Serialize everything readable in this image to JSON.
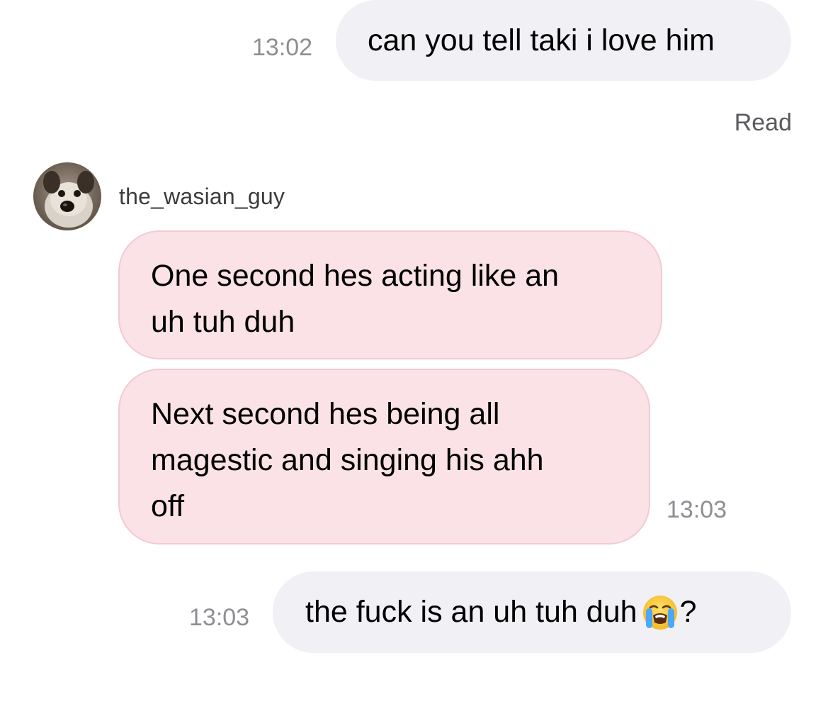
{
  "conversation": {
    "messages": [
      {
        "direction": "outgoing",
        "text": "can you tell taki i love him",
        "time": "13:02"
      },
      {
        "direction": "incoming",
        "sender": "the_wasian_guy",
        "text_lines": [
          "One second hes acting like an",
          "uh tuh duh"
        ]
      },
      {
        "direction": "incoming",
        "sender": "the_wasian_guy",
        "text_lines": [
          "Next second hes being all",
          "magestic and singing his ahh",
          "off"
        ],
        "time": "13:03"
      },
      {
        "direction": "outgoing",
        "text": "the fuck is an uh tuh duh",
        "emoji": "loudly-crying-face-emoji",
        "suffix": "?",
        "time": "13:03"
      }
    ],
    "read_receipt": "Read",
    "contact": {
      "username": "the_wasian_guy",
      "avatar_icon": "dog-avatar"
    }
  },
  "colors": {
    "outgoing_bubble": "#f0f0f5",
    "incoming_bubble": "#fae2e6",
    "incoming_border": "#f4c9d2",
    "timestamp": "#8e8e93"
  }
}
